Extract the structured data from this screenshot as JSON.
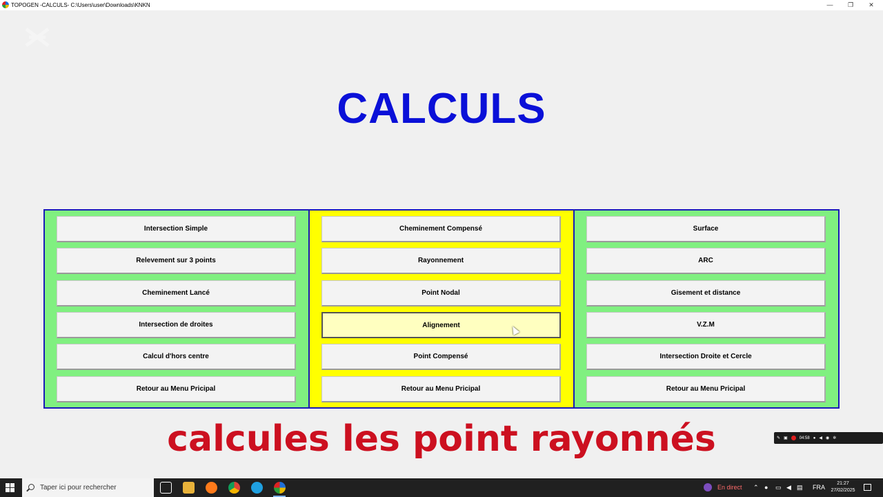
{
  "window": {
    "title": "TOPOGEN -CALCULS- C:\\Users\\user\\Downloads\\KNKN",
    "minimize": "—",
    "restore": "❐",
    "close": "✕"
  },
  "heading": "CALCULS",
  "panels": {
    "left": {
      "buttons": [
        "Intersection Simple",
        "Relevement sur 3 points",
        "Cheminement Lancé",
        "Intersection de droites",
        "Calcul d'hors centre",
        "Retour au Menu Pricipal"
      ]
    },
    "middle": {
      "buttons": [
        "Cheminement Compensé",
        "Rayonnement",
        "Point Nodal",
        "Alignement",
        "Point Compensé",
        "Retour au Menu Pricipal"
      ],
      "selected": "Alignement"
    },
    "right": {
      "buttons": [
        "Surface",
        "ARC",
        "Gisement et distance",
        "V.Z.M",
        "Intersection Droite et Cercle",
        "Retour au Menu Pricipal"
      ]
    }
  },
  "subtitle": "calcules les point rayonnés",
  "recorder": {
    "timer": "04:58"
  },
  "taskbar": {
    "search_placeholder": "Taper ici pour rechercher",
    "live_label": "En direct",
    "language": "FRA",
    "time": "21:27",
    "date": "27/02/2025"
  },
  "colors": {
    "heading": "#0a10d8",
    "panel_green": "#80f080",
    "panel_yellow": "#ffff00",
    "panel_border": "#1a1ab8",
    "subtitle": "#cc1020"
  }
}
